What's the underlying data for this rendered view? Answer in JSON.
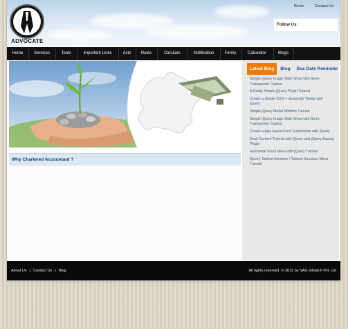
{
  "header": {
    "logo_text": "ADVOCATE",
    "top_links": [
      "Home",
      "Contact Us"
    ],
    "follow_label": "Follow Us:"
  },
  "nav": {
    "items": [
      "Home",
      "Services",
      "Tools",
      "Important Links",
      "Acts",
      "Rules",
      "Circulars",
      "Notification",
      "Forms",
      "Calculator",
      "Blogs"
    ]
  },
  "main": {
    "section_title": "Why Chartered Accountant ?"
  },
  "sidebar": {
    "tabs": [
      "Latest Blog",
      "Blog",
      "Due Date Reminder"
    ],
    "active_tab_color": "#f07b00",
    "items": [
      "Simple jQuery Image Slide Show with Semi-Transparent Caption",
      "A Really Simple jQuery Plugin Tutorial",
      "Create a Simple CSS + Javascript Tooltip with jQuery",
      "Simple jQuery Modal Window Tutorial",
      "Simple jQuery Image Slide Show with Semi-Transparent Caption",
      "Create a Ajax based Form Submission with jQuery",
      "Dock Content Tutorial with jQuery and jQuery Easing Plugin",
      "Horizontal Scroll Menu with jQuery Tutorial",
      "jQuery Tabbed Interface / Tabbed Structure Menu Tutorial"
    ]
  },
  "footer": {
    "links": [
      "About Us",
      "Contact Us",
      "Blog"
    ],
    "copyright": "All rights reserved. © 2012 by  SAG Infotech Pvt. Ltd"
  }
}
